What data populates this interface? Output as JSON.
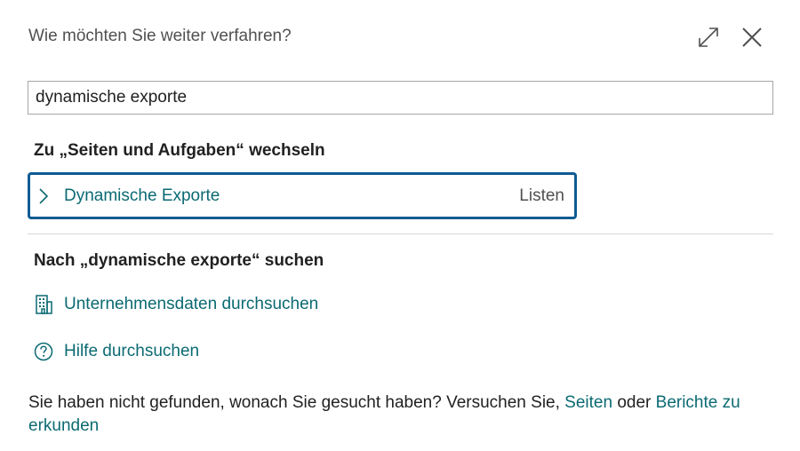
{
  "header": {
    "title": "Wie möchten Sie weiter verfahren?"
  },
  "search": {
    "value": "dynamische exporte"
  },
  "pages_section": {
    "title": "Zu „Seiten und Aufgaben“ wechseln",
    "results": [
      {
        "label": "Dynamische Exporte",
        "category": "Listen"
      }
    ]
  },
  "search_section": {
    "title": "Nach „dynamische exporte“ suchen",
    "links": [
      {
        "label": "Unternehmensdaten durchsuchen",
        "icon": "building-icon"
      },
      {
        "label": "Hilfe durchsuchen",
        "icon": "help-circle-icon"
      }
    ]
  },
  "footer": {
    "text_before": "Sie haben nicht gefunden, wonach Sie gesucht haben? Versuchen Sie, ",
    "link_pages": "Seiten",
    "text_middle": " oder ",
    "link_reports": "Berichte zu erkunden"
  },
  "colors": {
    "accent_link": "#0b6a72",
    "focus_border": "#0f5b93",
    "text": "#212121",
    "muted": "#505050"
  }
}
